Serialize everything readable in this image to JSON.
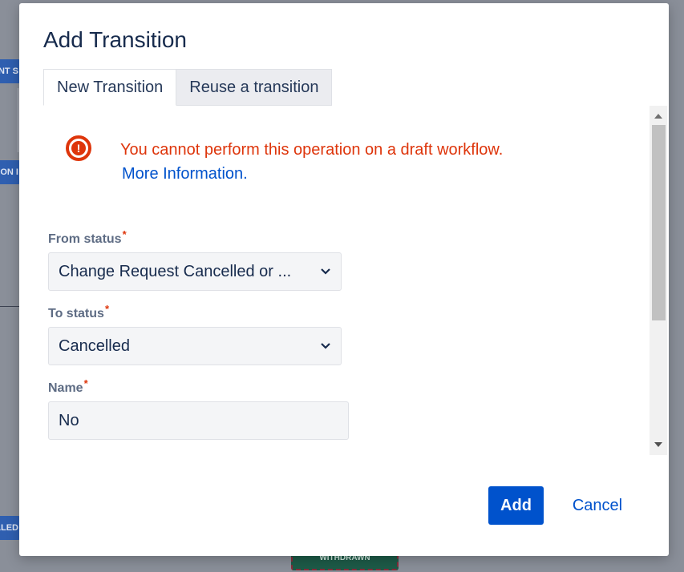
{
  "background": {
    "node_labels": [
      "NT S",
      "ON I",
      "LLED"
    ],
    "green_node_label": "WITHDRAWN"
  },
  "dialog": {
    "title": "Add Transition",
    "tabs": [
      {
        "label": "New Transition",
        "active": true
      },
      {
        "label": "Reuse a transition",
        "active": false
      }
    ],
    "error": {
      "icon": "error-icon",
      "message": "You cannot perform this operation on a draft workflow.",
      "link": "More Information."
    },
    "fields": {
      "from_status": {
        "label": "From status",
        "required_marker": "*",
        "value": "Change Request Cancelled or ..."
      },
      "to_status": {
        "label": "To status",
        "required_marker": "*",
        "value": "Cancelled"
      },
      "name": {
        "label": "Name",
        "required_marker": "*",
        "value": "No"
      }
    },
    "buttons": {
      "add": "Add",
      "cancel": "Cancel"
    }
  },
  "colors": {
    "primary": "#0052cc",
    "error": "#de350b",
    "title": "#172b4d",
    "label": "#5e6c84"
  }
}
